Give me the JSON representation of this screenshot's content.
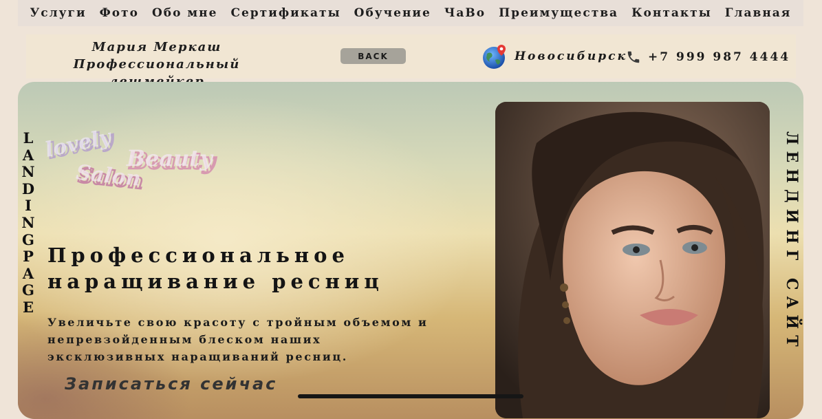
{
  "nav": {
    "items": [
      "Услуги",
      "Фото",
      "Обо мне",
      "Сертификаты",
      "Обучение",
      "ЧаВо",
      "Преимущества",
      "Контакты",
      "Главная"
    ]
  },
  "header": {
    "brand_name": "Мария Меркаш",
    "brand_role": "Профессиональный лешмейкер",
    "back_label": "BACK",
    "city": "Новосибирск",
    "phone": "+7 999 987 4444"
  },
  "hero": {
    "vertical_left": [
      "L",
      "A",
      "N",
      "D",
      "I",
      "N",
      "G",
      "P",
      "A",
      "G",
      "E"
    ],
    "vertical_right": "ЛЕНДИНГ САЙТ",
    "logo_words": [
      "lovely",
      "Beauty",
      "Salon"
    ],
    "title_line1": "Профессиональное",
    "title_line2": "наращивание ресниц",
    "subtitle": "Увеличьте свою красоту с тройным объемом и непревзойденным блеском наших эксклюзивных наращиваний ресниц.",
    "cta_label": "Записаться сейчас"
  },
  "colors": {
    "nav_bg": "#e8dfd8",
    "infobar_bg": "#f1e6d3",
    "back_button": "#a6a39a",
    "page_bg": "#efe4d8"
  },
  "icons": {
    "location": "globe-pin-icon",
    "phone": "phone-icon"
  }
}
